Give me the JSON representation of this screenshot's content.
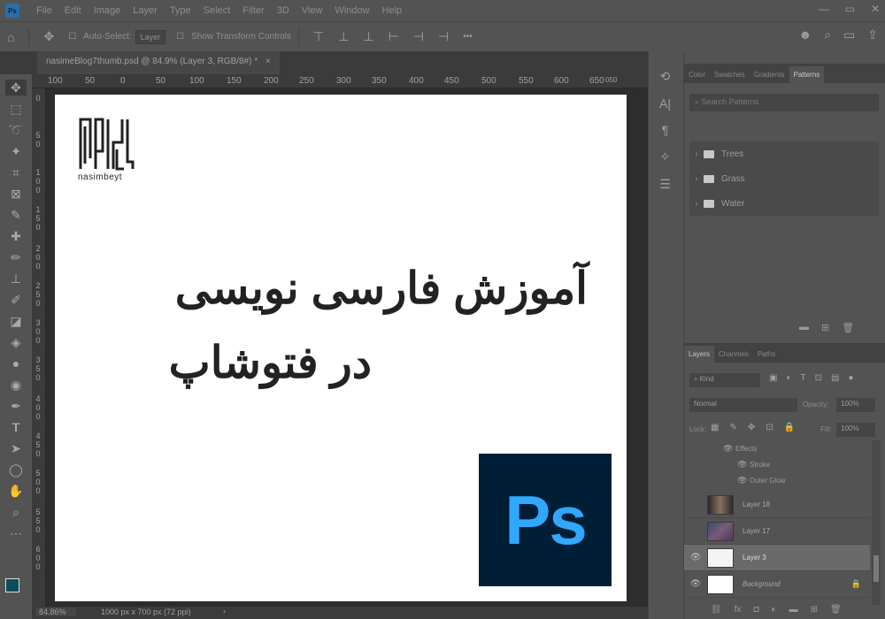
{
  "app": {
    "logo_text": "Ps",
    "menu": [
      "File",
      "Edit",
      "Image",
      "Layer",
      "Type",
      "Select",
      "Filter",
      "3D",
      "View",
      "Window",
      "Help"
    ],
    "window_controls": [
      "—",
      "▭",
      "✕"
    ]
  },
  "options_bar": {
    "auto_select_label": "Auto-Select:",
    "auto_select_target": "Layer",
    "show_transform_label": "Show Transform Controls",
    "more_label": "•••"
  },
  "document_tab": {
    "title": "nasimeBlog7thumb.psd @ 84.9% (Layer 3, RGB/8#) *",
    "close": "×"
  },
  "ruler": {
    "top_ticks": [
      "100",
      "50",
      "0",
      "50",
      "100",
      "150",
      "200",
      "250",
      "300",
      "350",
      "400",
      "450",
      "500",
      "550",
      "600",
      "650"
    ],
    "top_tail": "050",
    "left_ticks": [
      "0",
      "5 0",
      "1 0 0",
      "1 5 0",
      "2 0 0",
      "2 5 0",
      "3 0 0",
      "3 5 0",
      "4 0 0",
      "4 5 0",
      "5 0 0",
      "5 5 0",
      "6 0 0"
    ]
  },
  "canvas": {
    "brand_name": "nasimbeyt",
    "headline_line1": "آموزش فارسی نویسی",
    "headline_line2": "در فتوشاپ",
    "badge_text": "Ps",
    "badge_color": "#001e36",
    "badge_text_color": "#31a8ff"
  },
  "status": {
    "zoom": "84.86%",
    "doc_info": "1000 px x 700 px (72 ppi)",
    "arrow": "›"
  },
  "patterns_panel": {
    "tabs": [
      "Color",
      "Swatches",
      "Gradients",
      "Patterns"
    ],
    "active_tab": "Patterns",
    "search_placeholder": "Search Patterns",
    "folders": [
      "Trees",
      "Grass",
      "Water"
    ]
  },
  "layers_panel": {
    "tabs": [
      "Layers",
      "Channels",
      "Paths"
    ],
    "kind_filter": "Kind",
    "blend_mode": "Normal",
    "opacity_label": "Opacity:",
    "opacity_value": "100%",
    "lock_label": "Lock:",
    "fill_label": "Fill:",
    "fill_value": "100%",
    "effects": {
      "label": "Effects",
      "items": [
        "Stroke",
        "Outer Glow"
      ]
    },
    "layers": [
      {
        "name": "Layer 18",
        "visible": false,
        "selected": false
      },
      {
        "name": "Layer 17",
        "visible": false,
        "selected": false
      },
      {
        "name": "Layer 3",
        "visible": true,
        "selected": true
      },
      {
        "name": "Background",
        "visible": true,
        "selected": false,
        "locked": true
      }
    ]
  }
}
